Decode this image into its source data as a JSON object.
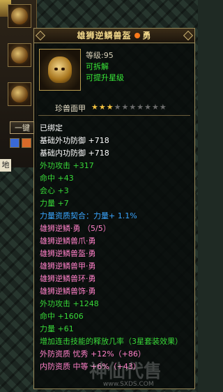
{
  "left_panel": {
    "button_label": "一键",
    "tab_label": "地"
  },
  "tooltip": {
    "title_name": "雄狮逆鳞兽盔",
    "title_suffix": "勇",
    "level": "等级:95",
    "status_1": "可拆解",
    "status_2": "可提升星级",
    "set_name": "珍兽面甲",
    "stars_filled": 3,
    "stars_total": 10,
    "lines": [
      {
        "text": "已绑定",
        "color": "white"
      },
      {
        "text": "基础外功防御 +718",
        "color": "white"
      },
      {
        "text": "基础内功防御 +718",
        "color": "white"
      },
      {
        "text": "外功攻击 +317",
        "color": "green"
      },
      {
        "text": "命中 +43",
        "color": "green"
      },
      {
        "text": "会心 +3",
        "color": "green"
      },
      {
        "text": "力量 +7",
        "color": "green"
      },
      {
        "text": "力量资质契合：力量+ 1.1%",
        "color": "blue"
      },
      {
        "text": "雄狮逆鳞·勇 （5/5）",
        "color": "pink"
      },
      {
        "text": "雄狮逆鳞兽爪·勇",
        "color": "pink"
      },
      {
        "text": "雄狮逆鳞兽盔·勇",
        "color": "pink"
      },
      {
        "text": "雄狮逆鳞兽甲·勇",
        "color": "pink"
      },
      {
        "text": "雄狮逆鳞兽环·勇",
        "color": "pink"
      },
      {
        "text": "雄狮逆鳞兽饰·勇",
        "color": "pink"
      },
      {
        "text": "外功攻击 +1248",
        "color": "green"
      },
      {
        "text": "命中 +1606",
        "color": "green"
      },
      {
        "text": "力量 +61",
        "color": "green"
      },
      {
        "text": "增加连击技能的释放几率（3星套装效果）",
        "color": "green",
        "wrap": true
      },
      {
        "text": "外防资质 忧秀 +12%（+86）",
        "color": "pink"
      },
      {
        "text": "内防资质 中等 +6%（+43）",
        "color": "pink"
      }
    ]
  },
  "watermark": {
    "text": "神仙代售",
    "site": "www.SXDS.COM"
  },
  "colors": {
    "white": "#ffffff",
    "green": "#38d838",
    "blue": "#3aa6ff",
    "pink": "#ff80c8",
    "gold": "#f0d68a",
    "orange_dot": "#ff7a1a"
  },
  "icons": {
    "item_icon": "lion-helmet-icon",
    "star_icon": "star-icon"
  }
}
